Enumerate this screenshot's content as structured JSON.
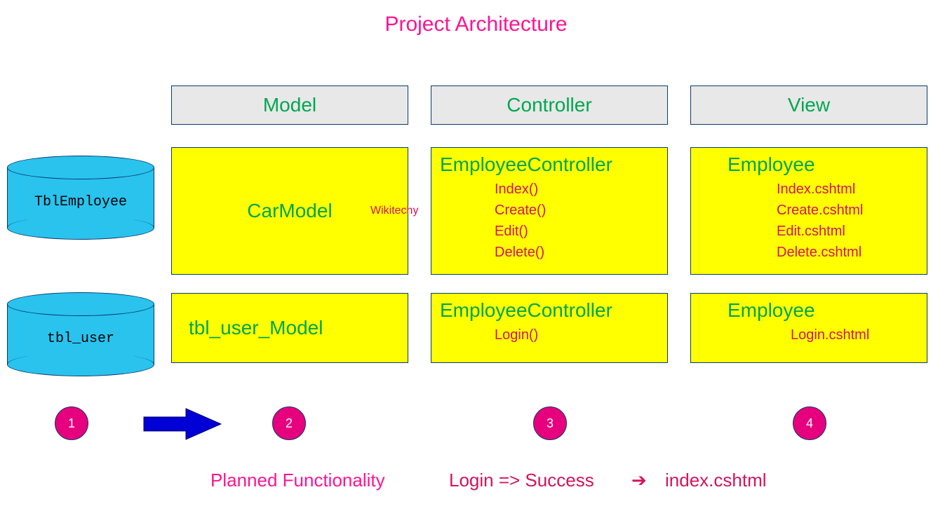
{
  "title": "Project Architecture",
  "watermark": "Wikitechy",
  "headers": {
    "model": "Model",
    "controller": "Controller",
    "view": "View"
  },
  "databases": {
    "db1": "TblEmployee",
    "db2": "tbl_user"
  },
  "models": {
    "row1": "CarModel",
    "row2": "tbl_user_Model"
  },
  "controllers": {
    "row1": {
      "name": "EmployeeController",
      "methods": [
        "Index()",
        "Create()",
        "Edit()",
        "Delete()"
      ]
    },
    "row2": {
      "name": "EmployeeController",
      "methods": [
        "Login()"
      ]
    }
  },
  "views": {
    "row1": {
      "name": "Employee",
      "files": [
        "Index.cshtml",
        "Create.cshtml",
        "Edit.cshtml",
        "Delete.cshtml"
      ]
    },
    "row2": {
      "name": "Employee",
      "files": [
        "Login.cshtml"
      ]
    }
  },
  "badges": {
    "b1": "1",
    "b2": "2",
    "b3": "3",
    "b4": "4"
  },
  "footer": {
    "label": "Planned Functionality",
    "flow1": "Login => Success",
    "flow2": "index.cshtml"
  }
}
